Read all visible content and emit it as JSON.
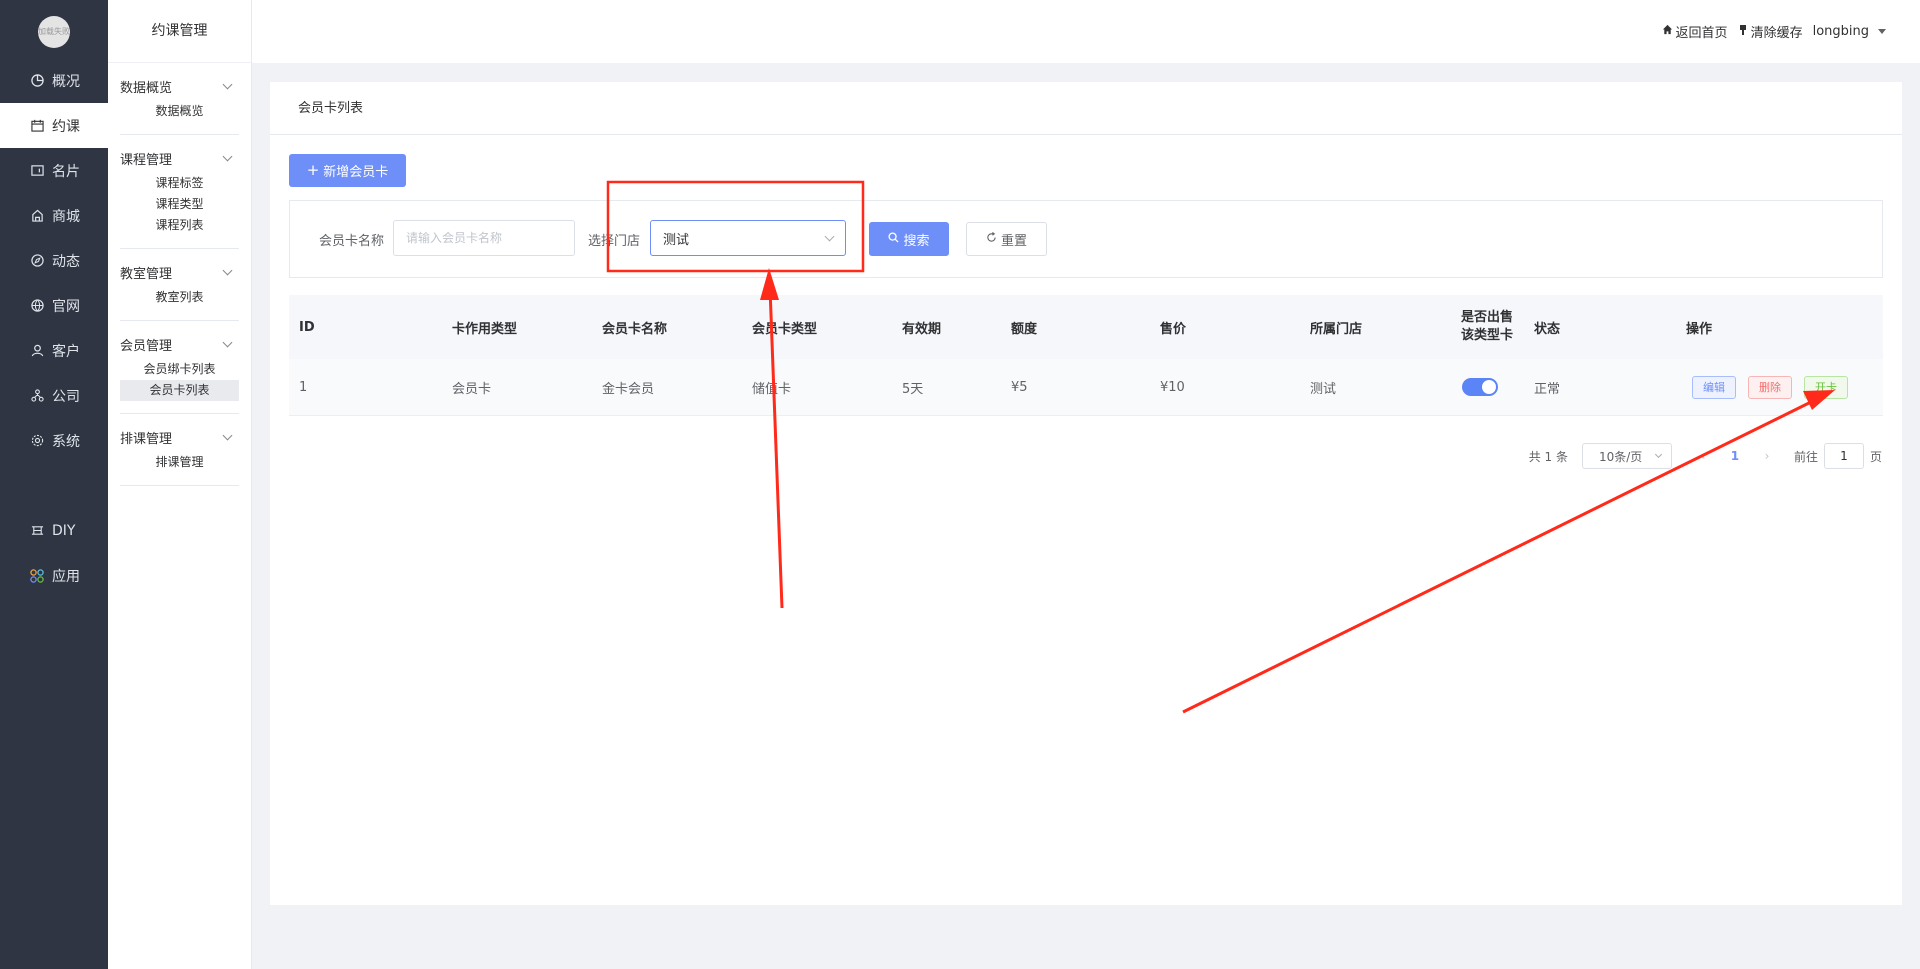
{
  "logo_text": "加载失败",
  "nav": {
    "items": [
      {
        "label": "概况",
        "icon": "pie-chart-icon"
      },
      {
        "label": "约课",
        "icon": "calendar-icon",
        "active": true
      },
      {
        "label": "名片",
        "icon": "card-icon"
      },
      {
        "label": "商城",
        "icon": "shop-icon"
      },
      {
        "label": "动态",
        "icon": "compass-icon"
      },
      {
        "label": "官网",
        "icon": "globe-icon"
      },
      {
        "label": "客户",
        "icon": "user-icon"
      },
      {
        "label": "公司",
        "icon": "org-icon"
      },
      {
        "label": "系统",
        "icon": "gear-icon"
      }
    ],
    "extra": [
      {
        "label": "DIY",
        "icon": "diy-icon"
      },
      {
        "label": "应用",
        "icon": "apps-icon"
      }
    ]
  },
  "subnav": {
    "title": "约课管理",
    "groups": [
      {
        "title": "数据概览",
        "items": [
          "数据概览"
        ]
      },
      {
        "title": "课程管理",
        "items": [
          "课程标签",
          "课程类型",
          "课程列表"
        ]
      },
      {
        "title": "教室管理",
        "items": [
          "教室列表"
        ]
      },
      {
        "title": "会员管理",
        "items": [
          "会员绑卡列表",
          "会员卡列表"
        ],
        "active": "会员卡列表"
      },
      {
        "title": "排课管理",
        "items": [
          "排课管理"
        ]
      }
    ]
  },
  "topbar": {
    "home": "返回首页",
    "clear_cache": "清除缓存",
    "user": "longbing"
  },
  "panel": {
    "title": "会员卡列表",
    "add_button": "新增会员卡"
  },
  "filter": {
    "name_label": "会员卡名称",
    "name_placeholder": "请输入会员卡名称",
    "name_value": "",
    "store_label": "选择门店",
    "store_value": "测试",
    "search_button": "搜索",
    "reset_button": "重置"
  },
  "table": {
    "columns": [
      "ID",
      "卡作用类型",
      "会员卡名称",
      "会员卡类型",
      "有效期",
      "额度",
      "售价",
      "所属门店",
      "是否出售该类型卡",
      "状态",
      "操作"
    ],
    "sale_col_line1": "是否出售",
    "sale_col_line2": "该类型卡",
    "rows": [
      {
        "id": "1",
        "card_use_type": "会员卡",
        "name": "金卡会员",
        "card_type": "储值卡",
        "validity": "5天",
        "amount": "¥5",
        "price": "¥10",
        "store": "测试",
        "on_sale": true,
        "status": "正常"
      }
    ],
    "actions": {
      "edit": "编辑",
      "delete": "删除",
      "open": "开卡"
    }
  },
  "pagination": {
    "total": "共 1 条",
    "page_size": "10条/页",
    "current": "1",
    "goto_label": "前往",
    "goto_value": "1",
    "page_suffix": "页"
  },
  "colors": {
    "accent": "#6f8ff8",
    "sidebar_bg": "#2f3542",
    "annotation": "#ff2a1a"
  }
}
